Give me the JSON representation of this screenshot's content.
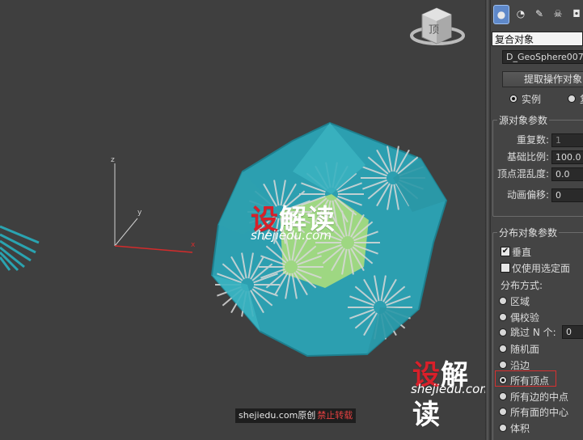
{
  "viewport": {
    "axes": {
      "x": "x",
      "y": "y",
      "z": "z"
    },
    "viewcube_face": "顶"
  },
  "watermark": {
    "brand_first": "设",
    "brand_rest": "解读",
    "site": "shejiedu.com",
    "credit_main": "shejiedu.com原创",
    "credit_warn": "禁止转载"
  },
  "panel": {
    "tab_icons": [
      "sphere-icon",
      "shapes-icon",
      "lights-icon",
      "helpers-icon",
      "camera-icon"
    ],
    "object_type": "复合对象",
    "object_name": "D_GeoSphere007",
    "extract_button": "提取操作对象",
    "instance_label": "实例",
    "copy_label": "复",
    "source_params_title": "源对象参数",
    "source_params": [
      {
        "label": "重复数:",
        "value": "1"
      },
      {
        "label": "基础比例:",
        "value": "100.0"
      },
      {
        "label": "顶点混乱度:",
        "value": "0.0"
      },
      {
        "label": "动画偏移:",
        "value": "0"
      }
    ],
    "distrib_params_title": "分布对象参数",
    "vertical_label": "垂直",
    "vertical_checked": true,
    "selected_faces_label": "仅使用选定面",
    "selected_faces_checked": false,
    "method_title": "分布方式:",
    "methods": [
      "区域",
      "偶校验",
      "跳过 N 个:",
      "随机面",
      "沿边",
      "所有顶点",
      "所有边的中点",
      "所有面的中心",
      "体积"
    ],
    "selected_method": "所有顶点",
    "skip_n_value": "0"
  }
}
